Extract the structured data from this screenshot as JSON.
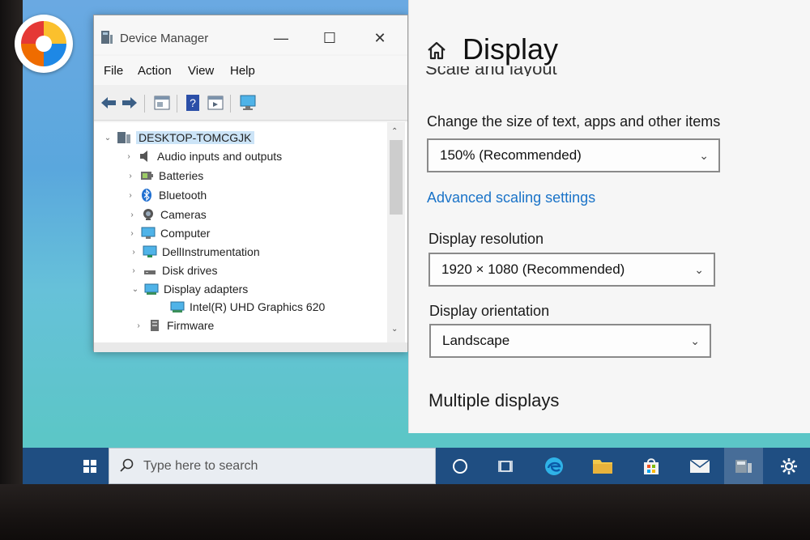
{
  "device_manager": {
    "title": "Device Manager",
    "menu": [
      "File",
      "Action",
      "View",
      "Help"
    ],
    "tree": {
      "root": "DESKTOP-TOMCGJK",
      "items": [
        {
          "label": "Audio inputs and outputs",
          "icon": "speaker-icon"
        },
        {
          "label": "Batteries",
          "icon": "battery-icon"
        },
        {
          "label": "Bluetooth",
          "icon": "bluetooth-icon"
        },
        {
          "label": "Cameras",
          "icon": "camera-icon"
        },
        {
          "label": "Computer",
          "icon": "computer-icon"
        },
        {
          "label": "DellInstrumentation",
          "icon": "monitor-icon"
        },
        {
          "label": "Disk drives",
          "icon": "disk-icon"
        },
        {
          "label": "Display adapters",
          "icon": "display-adapter-icon",
          "expanded": true
        },
        {
          "label": "Intel(R) UHD Graphics 620",
          "icon": "display-adapter-icon",
          "child": true
        },
        {
          "label": "Firmware",
          "icon": "firmware-icon"
        }
      ]
    }
  },
  "settings": {
    "heading": "Display",
    "cut_section": "Scale and layout",
    "scale_label": "Change the size of text, apps and other items",
    "scale_value": "150% (Recommended)",
    "advanced_link": "Advanced scaling settings",
    "resolution_label": "Display resolution",
    "resolution_value": "1920 × 1080 (Recommended)",
    "orientation_label": "Display orientation",
    "orientation_value": "Landscape",
    "multiple_heading": "Multiple displays"
  },
  "taskbar": {
    "search_placeholder": "Type here to search",
    "icons": [
      "start-icon",
      "cortana-icon",
      "task-view-icon",
      "edge-icon",
      "file-explorer-icon",
      "store-icon",
      "mail-icon",
      "device-manager-icon",
      "settings-gear-icon"
    ]
  },
  "colors": {
    "taskbar": "#1f4e82",
    "link": "#1a73c8",
    "selection": "#cce4f7"
  }
}
